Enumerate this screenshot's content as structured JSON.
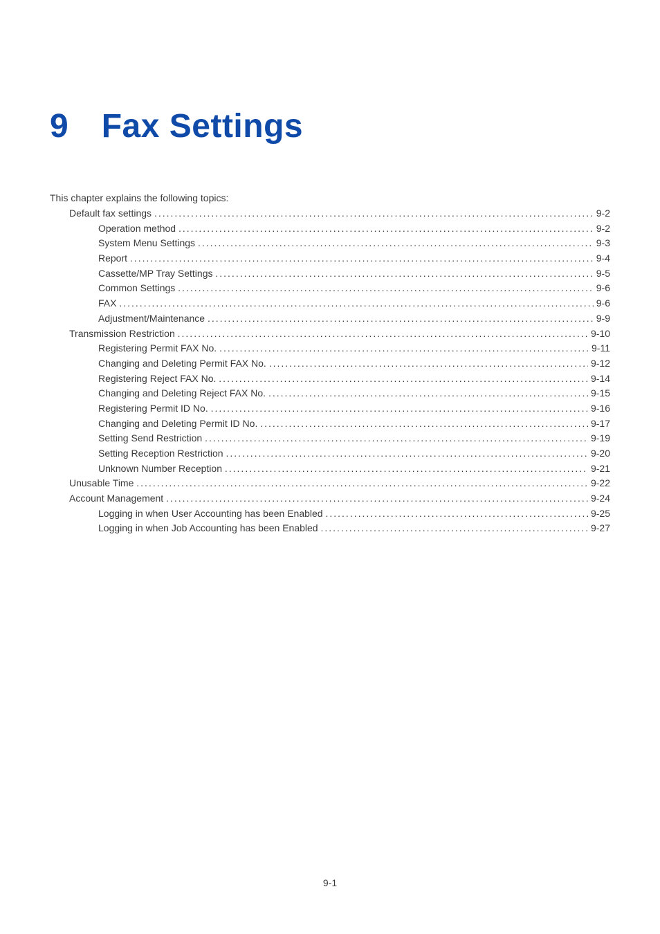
{
  "chapter": {
    "number": "9",
    "title": "Fax Settings"
  },
  "intro": "This chapter explains the following topics:",
  "toc": [
    {
      "level": 1,
      "label": "Default fax settings",
      "page": "9-2"
    },
    {
      "level": 2,
      "label": "Operation method",
      "page": "9-2"
    },
    {
      "level": 2,
      "label": "System Menu Settings",
      "page": "9-3"
    },
    {
      "level": 2,
      "label": "Report",
      "page": "9-4"
    },
    {
      "level": 2,
      "label": "Cassette/MP Tray Settings",
      "page": "9-5"
    },
    {
      "level": 2,
      "label": "Common Settings",
      "page": "9-6"
    },
    {
      "level": 2,
      "label": "FAX",
      "page": "9-6"
    },
    {
      "level": 2,
      "label": "Adjustment/Maintenance",
      "page": "9-9"
    },
    {
      "level": 1,
      "label": "Transmission Restriction",
      "page": "9-10"
    },
    {
      "level": 2,
      "label": "Registering Permit FAX No.",
      "page": "9-11"
    },
    {
      "level": 2,
      "label": "Changing and Deleting Permit FAX No.",
      "page": "9-12"
    },
    {
      "level": 2,
      "label": "Registering Reject FAX No.",
      "page": "9-14"
    },
    {
      "level": 2,
      "label": "Changing and Deleting Reject FAX No.",
      "page": "9-15"
    },
    {
      "level": 2,
      "label": "Registering Permit ID No.",
      "page": "9-16"
    },
    {
      "level": 2,
      "label": "Changing and Deleting Permit ID No.",
      "page": "9-17"
    },
    {
      "level": 2,
      "label": "Setting Send Restriction",
      "page": "9-19"
    },
    {
      "level": 2,
      "label": "Setting Reception Restriction",
      "page": "9-20"
    },
    {
      "level": 2,
      "label": "Unknown Number Reception",
      "page": "9-21"
    },
    {
      "level": 1,
      "label": "Unusable Time",
      "page": "9-22"
    },
    {
      "level": 1,
      "label": "Account Management",
      "page": "9-24"
    },
    {
      "level": 2,
      "label": "Logging in when User Accounting has been Enabled",
      "page": "9-25"
    },
    {
      "level": 2,
      "label": "Logging in when Job Accounting has been Enabled",
      "page": "9-27"
    }
  ],
  "page_number": "9-1"
}
